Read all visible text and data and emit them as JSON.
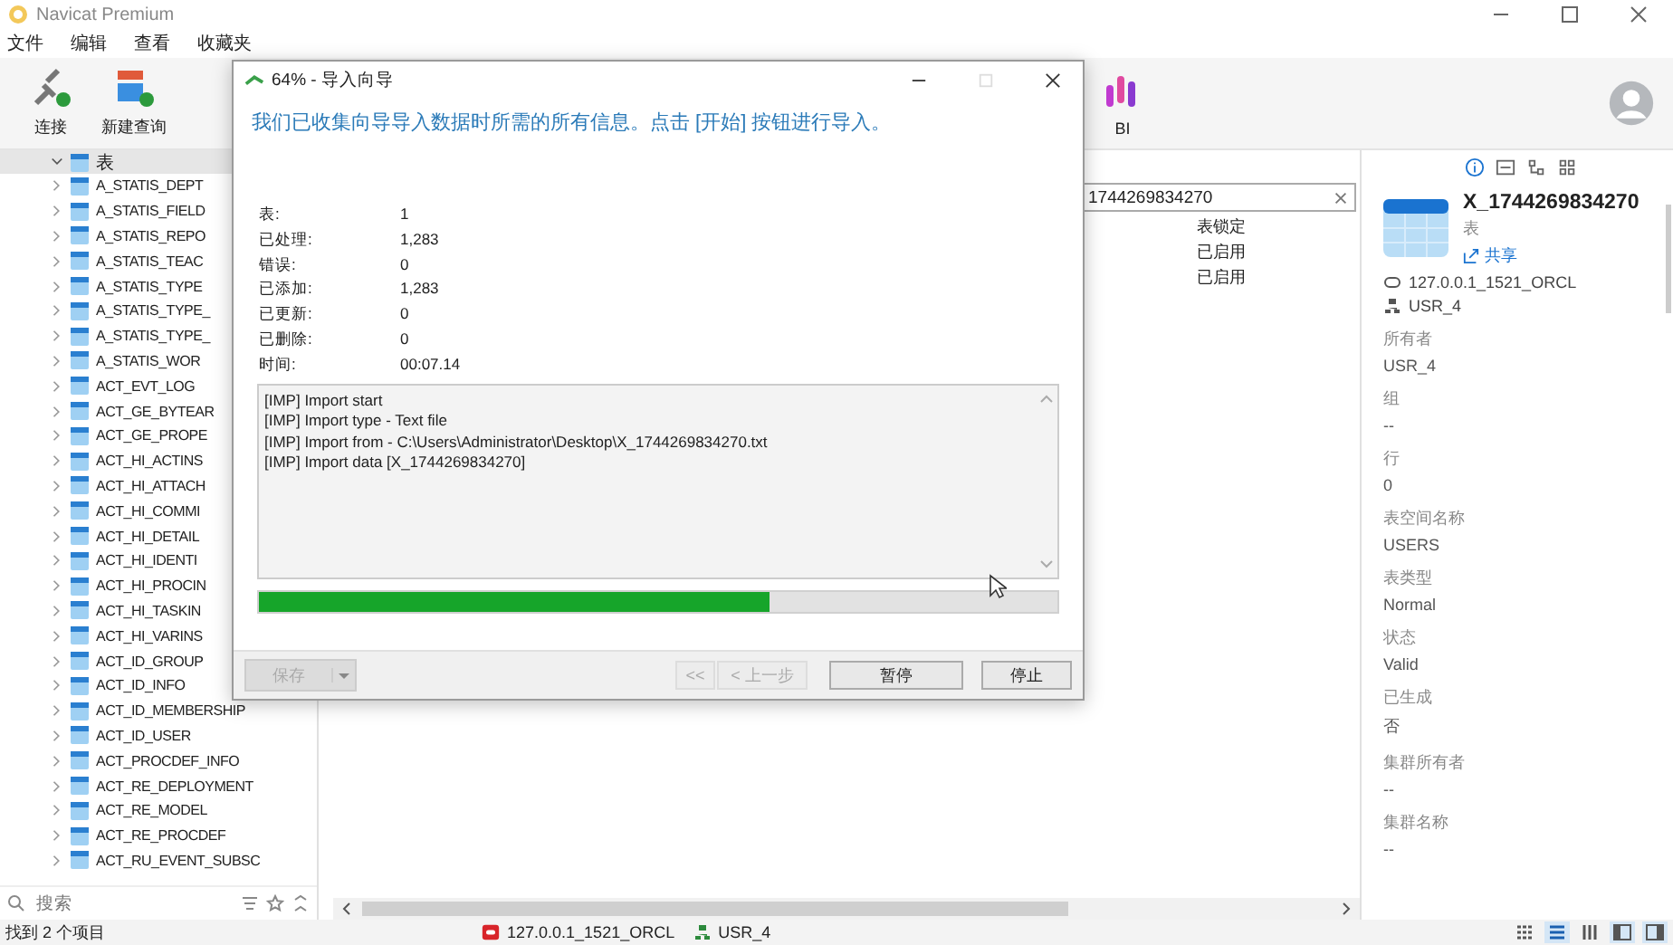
{
  "window": {
    "title": "Navicat Premium"
  },
  "menu": [
    "文件",
    "编辑",
    "查看",
    "收藏夹"
  ],
  "toolbar": [
    {
      "label": "连接",
      "kind": "connect"
    },
    {
      "label": "新建查询",
      "kind": "query"
    }
  ],
  "toolbar_right": [
    {
      "label": "BI",
      "kind": "bi"
    }
  ],
  "tree": {
    "label": "表",
    "expanded": true,
    "children": [
      {
        "label": "A_STATIS_DEPT"
      },
      {
        "label": "A_STATIS_FIELD"
      },
      {
        "label": "A_STATIS_REPO"
      },
      {
        "label": "A_STATIS_TEAC"
      },
      {
        "label": "A_STATIS_TYPE"
      },
      {
        "label": "A_STATIS_TYPE_"
      },
      {
        "label": "A_STATIS_TYPE_"
      },
      {
        "label": "A_STATIS_WOR"
      },
      {
        "label": "ACT_EVT_LOG"
      },
      {
        "label": "ACT_GE_BYTEAR"
      },
      {
        "label": "ACT_GE_PROPE"
      },
      {
        "label": "ACT_HI_ACTINS"
      },
      {
        "label": "ACT_HI_ATTACH"
      },
      {
        "label": "ACT_HI_COMMI"
      },
      {
        "label": "ACT_HI_DETAIL"
      },
      {
        "label": "ACT_HI_IDENTI"
      },
      {
        "label": "ACT_HI_PROCIN"
      },
      {
        "label": "ACT_HI_TASKIN"
      },
      {
        "label": "ACT_HI_VARINS"
      },
      {
        "label": "ACT_ID_GROUP"
      },
      {
        "label": "ACT_ID_INFO"
      },
      {
        "label": "ACT_ID_MEMBERSHIP"
      },
      {
        "label": "ACT_ID_USER"
      },
      {
        "label": "ACT_PROCDEF_INFO"
      },
      {
        "label": "ACT_RE_DEPLOYMENT"
      },
      {
        "label": "ACT_RE_MODEL"
      },
      {
        "label": "ACT_RE_PROCDEF"
      },
      {
        "label": "ACT_RU_EVENT_SUBSC"
      }
    ]
  },
  "tree_search": {
    "placeholder": "搜索"
  },
  "filter": {
    "value": "1744269834270"
  },
  "cells": [
    "表锁定",
    "已启用",
    "已启用"
  ],
  "details": {
    "name": "X_1744269834270",
    "type": "表",
    "share": "共享",
    "connection": "127.0.0.1_1521_ORCL",
    "schema": "USR_4",
    "properties": [
      {
        "label": "所有者",
        "value": "USR_4"
      },
      {
        "label": "组",
        "value": "--"
      },
      {
        "label": "行",
        "value": "0"
      },
      {
        "label": "表空间名称",
        "value": "USERS"
      },
      {
        "label": "表类型",
        "value": "Normal"
      },
      {
        "label": "状态",
        "value": "Valid"
      },
      {
        "label": "已生成",
        "value": "否"
      },
      {
        "label": "集群所有者",
        "value": "--"
      },
      {
        "label": "集群名称",
        "value": "--"
      }
    ]
  },
  "dialog": {
    "title": "64% - 导入向导",
    "heading": "我们已收集向导导入数据时所需的所有信息。点击 [开始] 按钮进行导入。",
    "stats": [
      {
        "label": "表:",
        "value": "1"
      },
      {
        "label": "已处理:",
        "value": "1,283"
      },
      {
        "label": "错误:",
        "value": "0"
      },
      {
        "label": "已添加:",
        "value": "1,283"
      },
      {
        "label": "已更新:",
        "value": "0"
      },
      {
        "label": "已删除:",
        "value": "0"
      },
      {
        "label": "时间:",
        "value": "00:07.14"
      }
    ],
    "log": [
      "[IMP] Import start",
      "[IMP] Import type - Text file",
      "[IMP] Import from - C:\\Users\\Administrator\\Desktop\\X_1744269834270.txt",
      "[IMP] Import data [X_1744269834270]"
    ],
    "progress": {
      "level": 0.64
    },
    "save": {
      "label": "保存",
      "disabled": true
    },
    "buttons": [
      {
        "label": "<<",
        "disabled": true
      },
      {
        "label": "< 上一步",
        "disabled": true
      },
      {
        "label": "暂停",
        "disabled": false
      },
      {
        "label": "停止",
        "disabled": false
      }
    ]
  },
  "status_bar": {
    "text": "找到 2 个项目",
    "connection": "127.0.0.1_1521_ORCL",
    "schema": "USR_4"
  }
}
